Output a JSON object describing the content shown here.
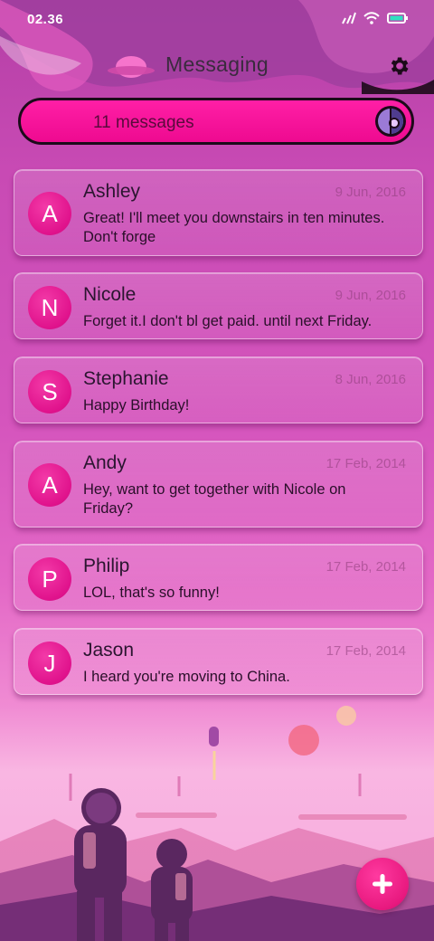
{
  "status_bar": {
    "time": "02.36"
  },
  "app_bar": {
    "title": "Messaging",
    "settings_icon": "gear-icon"
  },
  "count_bar": {
    "text": "11 messages",
    "avatar_icon": "contact-avatar-icon"
  },
  "messages": [
    {
      "initial": "A",
      "sender": "Ashley",
      "date": "9 Jun, 2016",
      "snippet": "Great! I'll meet you downstairs in ten minutes. Don't forge"
    },
    {
      "initial": "N",
      "sender": "Nicole",
      "date": "9 Jun, 2016",
      "snippet": "Forget it.I don't bl get paid. until next Friday."
    },
    {
      "initial": "S",
      "sender": "Stephanie",
      "date": "8 Jun, 2016",
      "snippet": "Happy Birthday!"
    },
    {
      "initial": "A",
      "sender": "Andy",
      "date": "17 Feb, 2014",
      "snippet": "Hey, want to get together with Nicole on Friday?"
    },
    {
      "initial": "P",
      "sender": "Philip",
      "date": "17 Feb, 2014",
      "snippet": "LOL, that's so funny!"
    },
    {
      "initial": "J",
      "sender": "Jason",
      "date": "17 Feb, 2014",
      "snippet": "I heard you're moving to China."
    }
  ],
  "fab": {
    "icon": "plus-icon"
  },
  "colors": {
    "accent": "#e8197f",
    "bar": "#ff1fa6",
    "text": "#2b1530"
  }
}
